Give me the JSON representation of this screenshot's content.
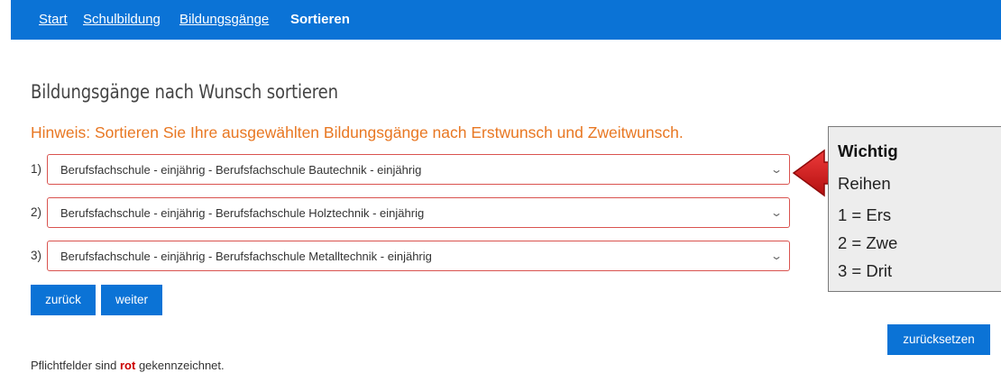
{
  "breadcrumb": {
    "items": [
      "Start",
      "Schulbildung",
      "Bildungsgänge"
    ],
    "current": "Sortieren"
  },
  "main": {
    "title": "Bildungsgänge nach Wunsch sortieren",
    "hint": "Hinweis: Sortieren Sie Ihre ausgewählten Bildungsgänge nach Erstwunsch und Zweitwunsch.",
    "rows": [
      {
        "number": "1)",
        "value": "Berufsfachschule - einjährig - Berufsfachschule Bautechnik - einjährig"
      },
      {
        "number": "2)",
        "value": "Berufsfachschule - einjährig - Berufsfachschule Holztechnik - einjährig"
      },
      {
        "number": "3)",
        "value": "Berufsfachschule - einjährig - Berufsfachschule Metalltechnik - einjährig"
      }
    ],
    "back_label": "zurück",
    "next_label": "weiter",
    "required_note_prefix": "Pflichtfelder sind ",
    "required_note_highlight": "rot",
    "required_note_suffix": " gekennzeichnet."
  },
  "infobox": {
    "title": "Wichtig",
    "lines": [
      "Reihen",
      "1 = Ers",
      "2 = Zwe",
      "3 = Drit"
    ]
  },
  "reset_label": "zurücksetzen",
  "colors": {
    "nav_bar": "#0b73d6",
    "hint": "#e87722",
    "field_border": "#d9534f",
    "arrow": "#d11a1a",
    "button": "#0b73d6"
  },
  "icons": {
    "select_chevron": "chevron-down-icon",
    "pointer": "red-arrow-left-icon"
  }
}
